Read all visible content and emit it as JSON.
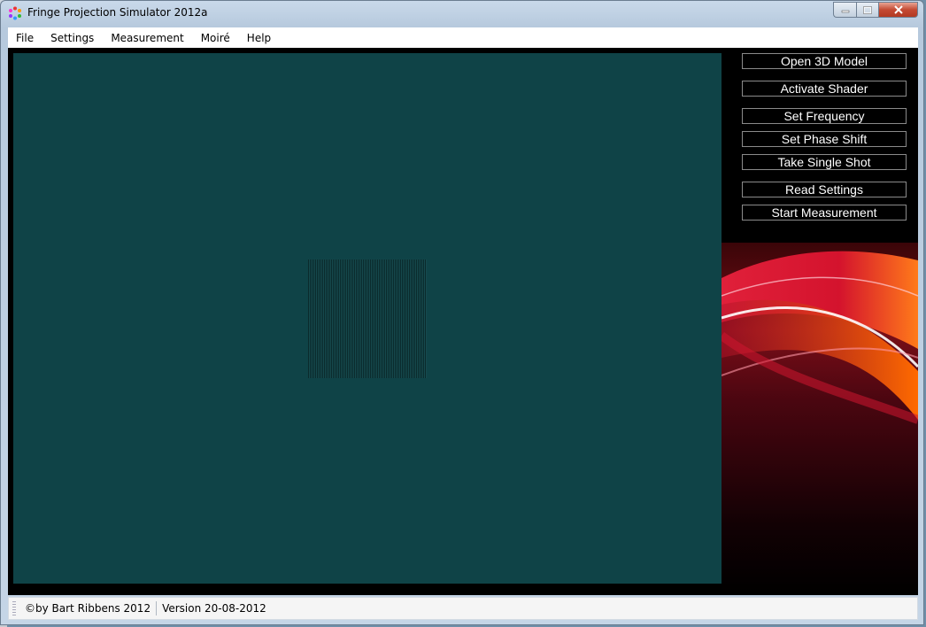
{
  "window": {
    "title": "Fringe Projection Simulator 2012a"
  },
  "menu": [
    "File",
    "Settings",
    "Measurement",
    "Moiré",
    "Help"
  ],
  "side_buttons": [
    "Open 3D Model",
    "Activate Shader",
    "Set Frequency",
    "Set Phase Shift",
    "Take Single Shot",
    "Read Settings",
    "Start Measurement"
  ],
  "status": {
    "copyright": "©by Bart Ribbens 2012",
    "version": "Version 20-08-2012"
  },
  "colors": {
    "viewport": "#0f4347",
    "background": "#000000",
    "accent": "#d9183a"
  }
}
